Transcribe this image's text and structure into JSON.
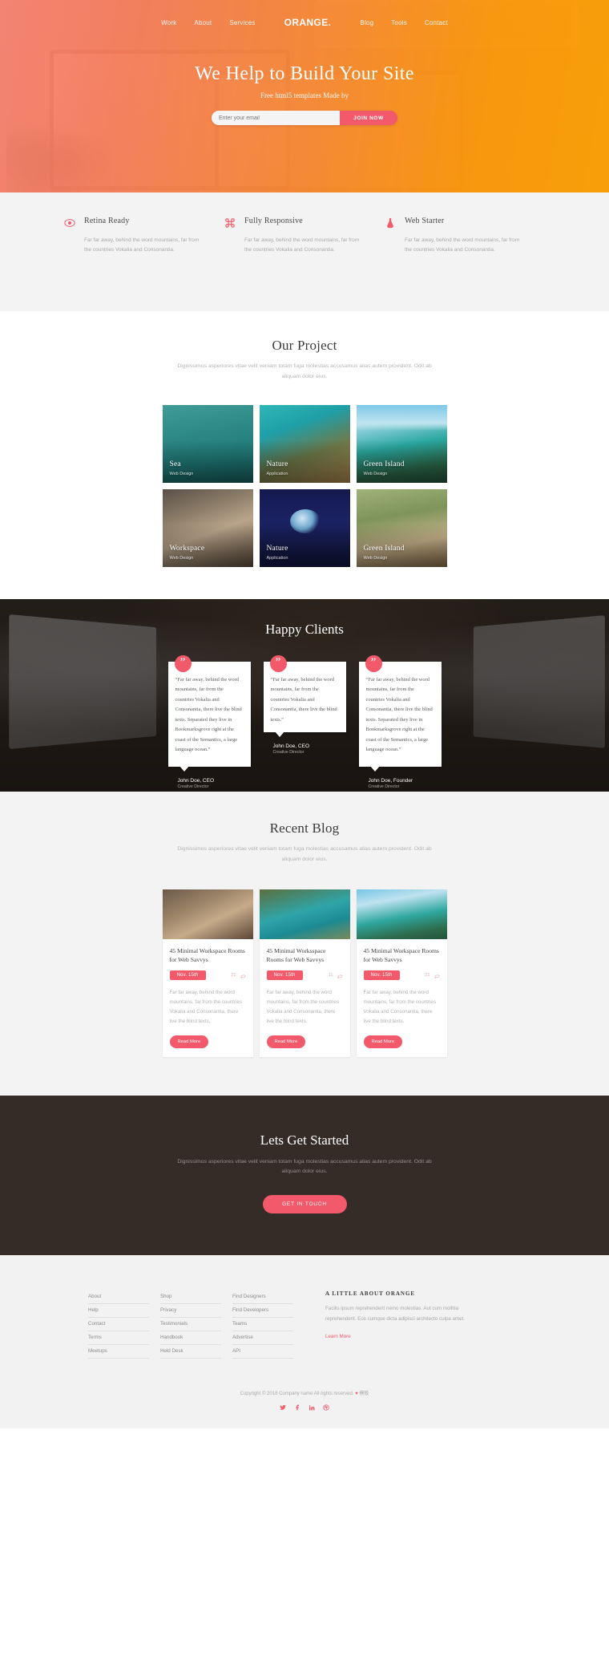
{
  "hero": {
    "nav_left": [
      {
        "label": "Work"
      },
      {
        "label": "About"
      },
      {
        "label": "Services"
      }
    ],
    "brand": "ORANGE.",
    "nav_right": [
      {
        "label": "Blog"
      },
      {
        "label": "Tools"
      },
      {
        "label": "Contact"
      }
    ],
    "title": "We Help to Build Your Site",
    "subtitle": "Free html5 templates Made by",
    "email_placeholder": "Enter your email",
    "email_value": "",
    "cta_label": "JOIN NOW",
    "accent": "#f2596b",
    "gradient_from": "#f87e6e",
    "gradient_to": "#fa9e00"
  },
  "features": [
    {
      "icon": "eye-icon",
      "title": "Retina Ready",
      "body": "Far far away, behind the word mountains, far from the countries Vokalia and Consonantia."
    },
    {
      "icon": "command-icon",
      "title": "Fully Responsive",
      "body": "Far far away, behind the word mountains, far from the countries Vokalia and Consonantia."
    },
    {
      "icon": "flask-icon",
      "title": "Web Starter",
      "body": "Far far away, behind the word mountains, far from the countries Vokalia and Consonantia."
    }
  ],
  "projects": {
    "title": "Our Project",
    "subtitle": "Dignissimos asperiores vitae velit veniam totam fuga molestias accusamus alias autem provident. Odit ab aliquam dolor eius.",
    "items": [
      {
        "name": "Sea",
        "category": "Web Design",
        "art": "p-sea"
      },
      {
        "name": "Nature",
        "category": "Application",
        "art": "p-nature"
      },
      {
        "name": "Green Island",
        "category": "Web Design",
        "art": "p-green"
      },
      {
        "name": "Workspace",
        "category": "Web Design",
        "art": "p-work"
      },
      {
        "name": "Nature",
        "category": "Application",
        "art": "p-nature2"
      },
      {
        "name": "Green Island",
        "category": "Web Design",
        "art": "p-green2"
      }
    ]
  },
  "clients": {
    "title": "Happy Clients",
    "quote_glyph": "”",
    "items": [
      {
        "text": "“Far far away, behind the word mountains, far from the countries Vokalia and Consonantia, there live the blind texts. Separated they live in Bookmarksgrove right at the coast of the Semantics, a large language ocean.”",
        "name": "John Doe, CEO",
        "role": "Creative Director"
      },
      {
        "text": "“Far far away, behind the word mountains, far from the countries Vokalia and Consonantia, there live the blind texts.”",
        "name": "John Doe, CEO",
        "role": "Creative Director"
      },
      {
        "text": "“Far far away, behind the word mountains, far from the countries Vokalia and Consonantia, there live the blind texts. Separated they live in Bookmarksgrove right at the coast of the Semantics, a large language ocean.”",
        "name": "John Doe, Founder",
        "role": "Creative Director"
      }
    ]
  },
  "blog": {
    "title": "Recent Blog",
    "subtitle": "Dignissimos asperiores vitae velit veniam totam fuga molestias accusamus alias autem provident. Odit ab aliquam dolor eius.",
    "posts": [
      {
        "title": "45 Minimal Workspace Rooms for Web Savvys",
        "date": "Nov. 15th",
        "likes": "21",
        "comments": "",
        "excerpt": "Far far away, behind the word mountains, far from the countries Vokalia and Consonantia, there live the blind texts.",
        "button": "Read More",
        "art": "b-work"
      },
      {
        "title": "45 Minimal Worksspace Rooms for Web Savvys",
        "date": "Nov. 15th",
        "likes": "11",
        "comments": "",
        "excerpt": "Far far away, behind the word mountains, far from the countries Vokalia and Consonantia, there live the blind texts.",
        "button": "Read More",
        "art": "b-sea"
      },
      {
        "title": "45 Minimal Workspace Rooms for Web Savvys",
        "date": "Nov. 15th",
        "likes": "21",
        "comments": "",
        "excerpt": "Far far away, behind the word mountains, far from the countries Vokalia and Consonantia, there live the blind texts.",
        "button": "Read More",
        "art": "b-green"
      }
    ]
  },
  "cta": {
    "title": "Lets Get Started",
    "subtitle": "Dignissimos asperiores vitae velit veniam totam fuga molestias accusamus alias autem provident. Odit ab aliquam dolor eius.",
    "button": "GET IN TOUCH"
  },
  "footer": {
    "columns": [
      {
        "links": [
          "About",
          "Help",
          "Contact",
          "Terms",
          "Meetups"
        ]
      },
      {
        "links": [
          "Shop",
          "Privacy",
          "Testimonials",
          "Handbook",
          "Held Desk"
        ]
      },
      {
        "links": [
          "Find Designers",
          "Find Developers",
          "Teams",
          "Advertise",
          "API"
        ]
      }
    ],
    "about_title": "A LITTLE ABOUT ORANGE",
    "about_text": "Facilis ipsum reprehenderit nemo molestias. Aut cum mollitia reprehenderit. Eos cumque dicta adipisci architecto culpa amet.",
    "about_link": "Learn More",
    "copyright_prefix": "Copyright © 2018 Company name All rights reserved.",
    "copyright_heart": "♥",
    "copyright_suffix": "模板",
    "socials": [
      {
        "name": "twitter-icon"
      },
      {
        "name": "facebook-icon"
      },
      {
        "name": "linkedin-icon"
      },
      {
        "name": "dribbble-icon"
      }
    ]
  }
}
